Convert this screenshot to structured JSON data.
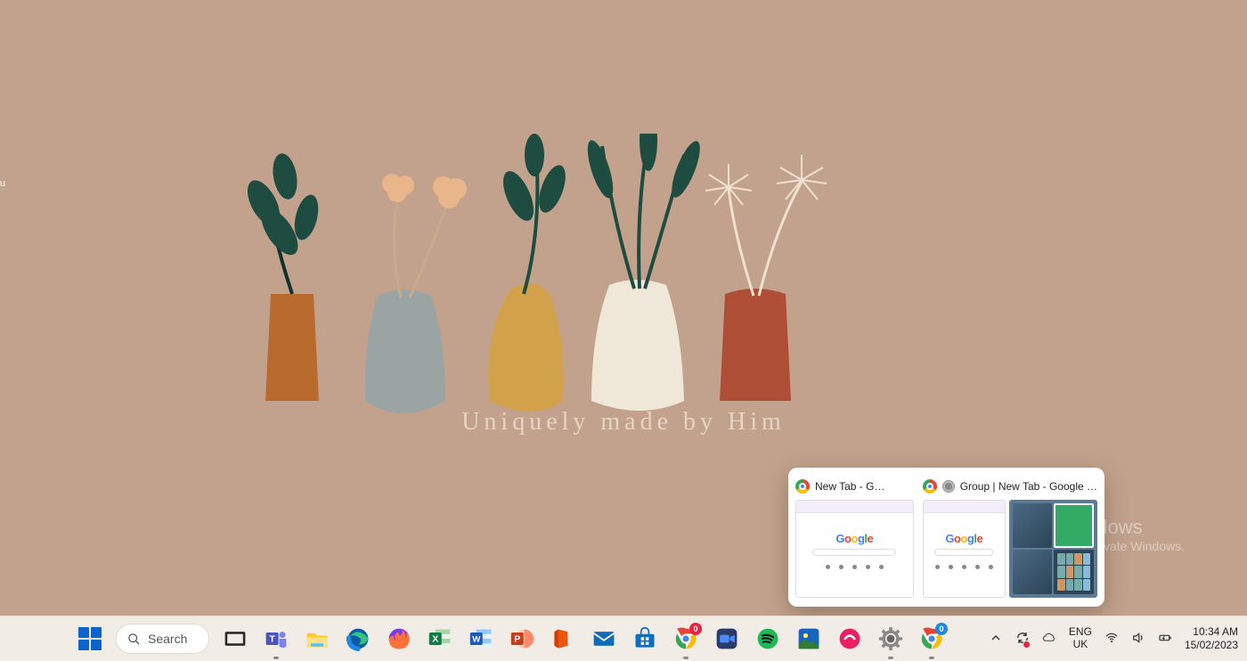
{
  "wallpaper": {
    "caption": "Uniquely made by Him"
  },
  "desktop_icon_fragment": "u",
  "watermark": {
    "title": "Activate Windows",
    "subtitle": "Go to Settings to activate Windows."
  },
  "taskbar": {
    "search_label": "Search",
    "apps": [
      {
        "name": "task-view",
        "badge": null,
        "active": false
      },
      {
        "name": "teams",
        "badge": null,
        "active": true
      },
      {
        "name": "file-explorer",
        "badge": null,
        "active": false
      },
      {
        "name": "edge",
        "badge": null,
        "active": false
      },
      {
        "name": "firefox",
        "badge": null,
        "active": false
      },
      {
        "name": "excel",
        "badge": null,
        "active": false
      },
      {
        "name": "word",
        "badge": null,
        "active": false
      },
      {
        "name": "powerpoint",
        "badge": null,
        "active": false
      },
      {
        "name": "office",
        "badge": null,
        "active": false
      },
      {
        "name": "mail",
        "badge": null,
        "active": false
      },
      {
        "name": "microsoft-store",
        "badge": null,
        "active": false
      },
      {
        "name": "chrome-1",
        "badge": "0",
        "active": true
      },
      {
        "name": "zoom",
        "badge": null,
        "active": false
      },
      {
        "name": "spotify",
        "badge": null,
        "active": false
      },
      {
        "name": "photos",
        "badge": null,
        "active": false
      },
      {
        "name": "app-pink",
        "badge": null,
        "active": false
      },
      {
        "name": "settings",
        "badge": null,
        "active": true
      },
      {
        "name": "chrome-2",
        "badge": "0",
        "active": true
      }
    ]
  },
  "preview": {
    "windows": [
      {
        "title": "New Tab - G…",
        "kind": "chrome-single"
      },
      {
        "title": "Group | New Tab - Google …",
        "kind": "chrome-group"
      }
    ]
  },
  "tray": {
    "language_top": "ENG",
    "language_bottom": "UK",
    "time": "10:34 AM",
    "date": "15/02/2023"
  }
}
